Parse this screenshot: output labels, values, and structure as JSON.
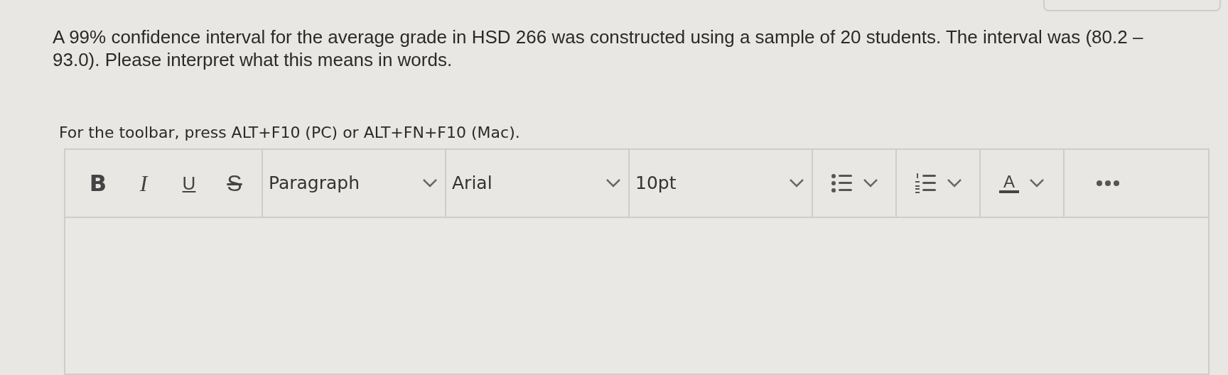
{
  "question": "A 99% confidence interval for the average grade in HSD 266 was constructed using a sample of 20 students. The interval was (80.2 – 93.0). Please interpret what this means in words.",
  "toolbar_hint": "For the toolbar, press ALT+F10 (PC) or ALT+FN+F10 (Mac).",
  "toolbar": {
    "format_buttons": [
      {
        "label": "B",
        "kind": "bold"
      },
      {
        "label": "I",
        "kind": "italic"
      },
      {
        "label": "U",
        "kind": "underline"
      },
      {
        "label": "S",
        "kind": "strike"
      }
    ],
    "dropdowns": [
      {
        "label": "Paragraph",
        "kind": "wide"
      },
      {
        "label": "Arial",
        "kind": "wide"
      },
      {
        "label": "10pt",
        "kind": "wide"
      }
    ],
    "list_buttons": [
      {
        "kind": "bullet"
      },
      {
        "kind": "numbered"
      }
    ],
    "font_color": "A"
  }
}
